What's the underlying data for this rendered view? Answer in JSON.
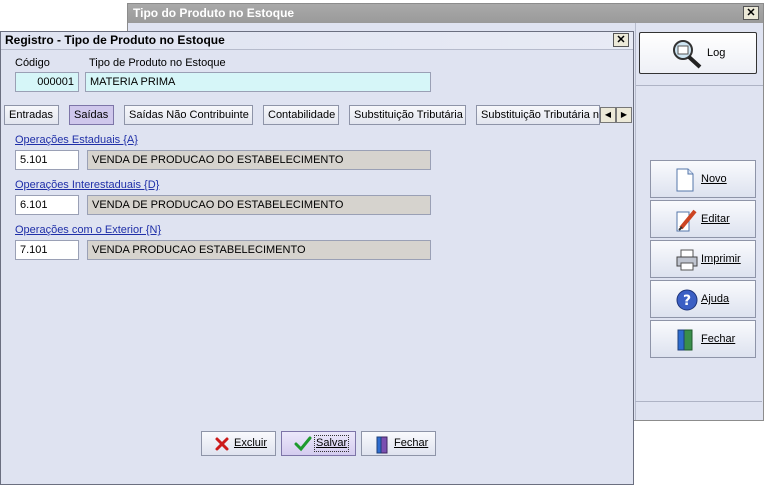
{
  "back_window": {
    "title": "Tipo do Produto no Estoque",
    "log_label": "Log",
    "buttons": {
      "novo": "Novo",
      "editar": "Editar",
      "imprimir": "Imprimir",
      "ajuda": "Ajuda",
      "fechar": "Fechar"
    }
  },
  "dialog": {
    "title": "Registro - Tipo de Produto no Estoque",
    "codigo_label": "Código",
    "codigo_value": "000001",
    "tipo_label": "Tipo de Produto no Estoque",
    "tipo_value": "MATERIA PRIMA",
    "tabs": [
      {
        "label": "Entradas"
      },
      {
        "label": "Saídas"
      },
      {
        "label": "Saídas Não Contribuinte"
      },
      {
        "label": "Contabilidade"
      },
      {
        "label": "Substituição Tributária"
      },
      {
        "label": "Substituição Tributária nã"
      }
    ],
    "active_tab": "Saídas",
    "sections": [
      {
        "label": "Operações Estaduais {A}",
        "code": "5.101",
        "description": "VENDA DE PRODUCAO DO ESTABELECIMENTO"
      },
      {
        "label": "Operações Interestaduais {D}",
        "code": "6.101",
        "description": "VENDA DE PRODUCAO DO ESTABELECIMENTO"
      },
      {
        "label": "Operações com o Exterior {N}",
        "code": "7.101",
        "description": "VENDA PRODUCAO ESTABELECIMENTO"
      }
    ],
    "buttons": {
      "excluir": "Excluir",
      "salvar": "Salvar",
      "fechar": "Fechar"
    }
  }
}
